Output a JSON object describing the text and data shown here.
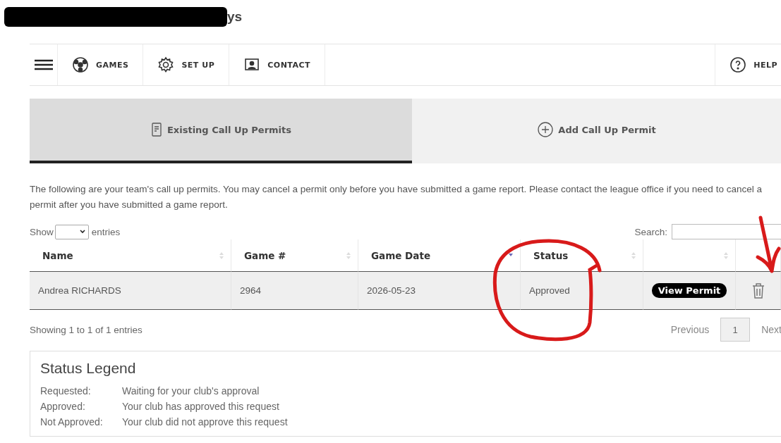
{
  "header": {
    "redacted": true,
    "text": "ys"
  },
  "nav": {
    "menu": true,
    "items": [
      {
        "kind": "games",
        "label": "GAMES"
      },
      {
        "kind": "setup",
        "label": "SET UP"
      },
      {
        "kind": "contact",
        "label": "CONTACT"
      }
    ],
    "help": {
      "kind": "help",
      "label": "HELP"
    }
  },
  "tabs": [
    {
      "kind": "list",
      "label": "Existing Call Up Permits",
      "selected": true
    },
    {
      "kind": "add",
      "label": "Add Call Up Permit",
      "selected": false
    }
  ],
  "intro": "The following are your team's call up permits. You may cancel a permit only before you have submitted a game report. Please contact the league office if you need to cancel a permit after you have submitted a game report.",
  "length_control": {
    "before": "Show",
    "after": "entries"
  },
  "search": {
    "label": "Search:"
  },
  "table": {
    "columns": [
      {
        "label": "Name",
        "sortable": true,
        "sorted": false
      },
      {
        "label": "Game #",
        "sortable": true,
        "sorted": false
      },
      {
        "label": "Game Date",
        "sortable": true,
        "sorted": true
      },
      {
        "label": "Status",
        "sortable": true,
        "sorted": false
      },
      {
        "sortable": true,
        "sorted": false
      },
      {}
    ],
    "rows": [
      {
        "name": "Andrea RICHARDS",
        "game": "2964",
        "date": "2026-05-23",
        "status": "Approved",
        "action": "View Permit",
        "deletable": true
      }
    ]
  },
  "info": "Showing 1 to 1 of 1 entries",
  "pagination": {
    "previous": "Previous",
    "pages": [
      {
        "label": "1",
        "selected": true
      }
    ],
    "next": "Next"
  },
  "legend": {
    "title": "Status Legend",
    "items": [
      {
        "term": "Requested:",
        "desc": "Waiting for your club's approval"
      },
      {
        "term": "Approved:",
        "desc": "Your club has approved this request"
      },
      {
        "term": "Not Approved:",
        "desc": "Your club did not approve this request"
      }
    ]
  },
  "circle_annotation": {
    "color": "#d81a1a"
  },
  "arrow_annotation": {
    "color": "#d81a1a"
  }
}
